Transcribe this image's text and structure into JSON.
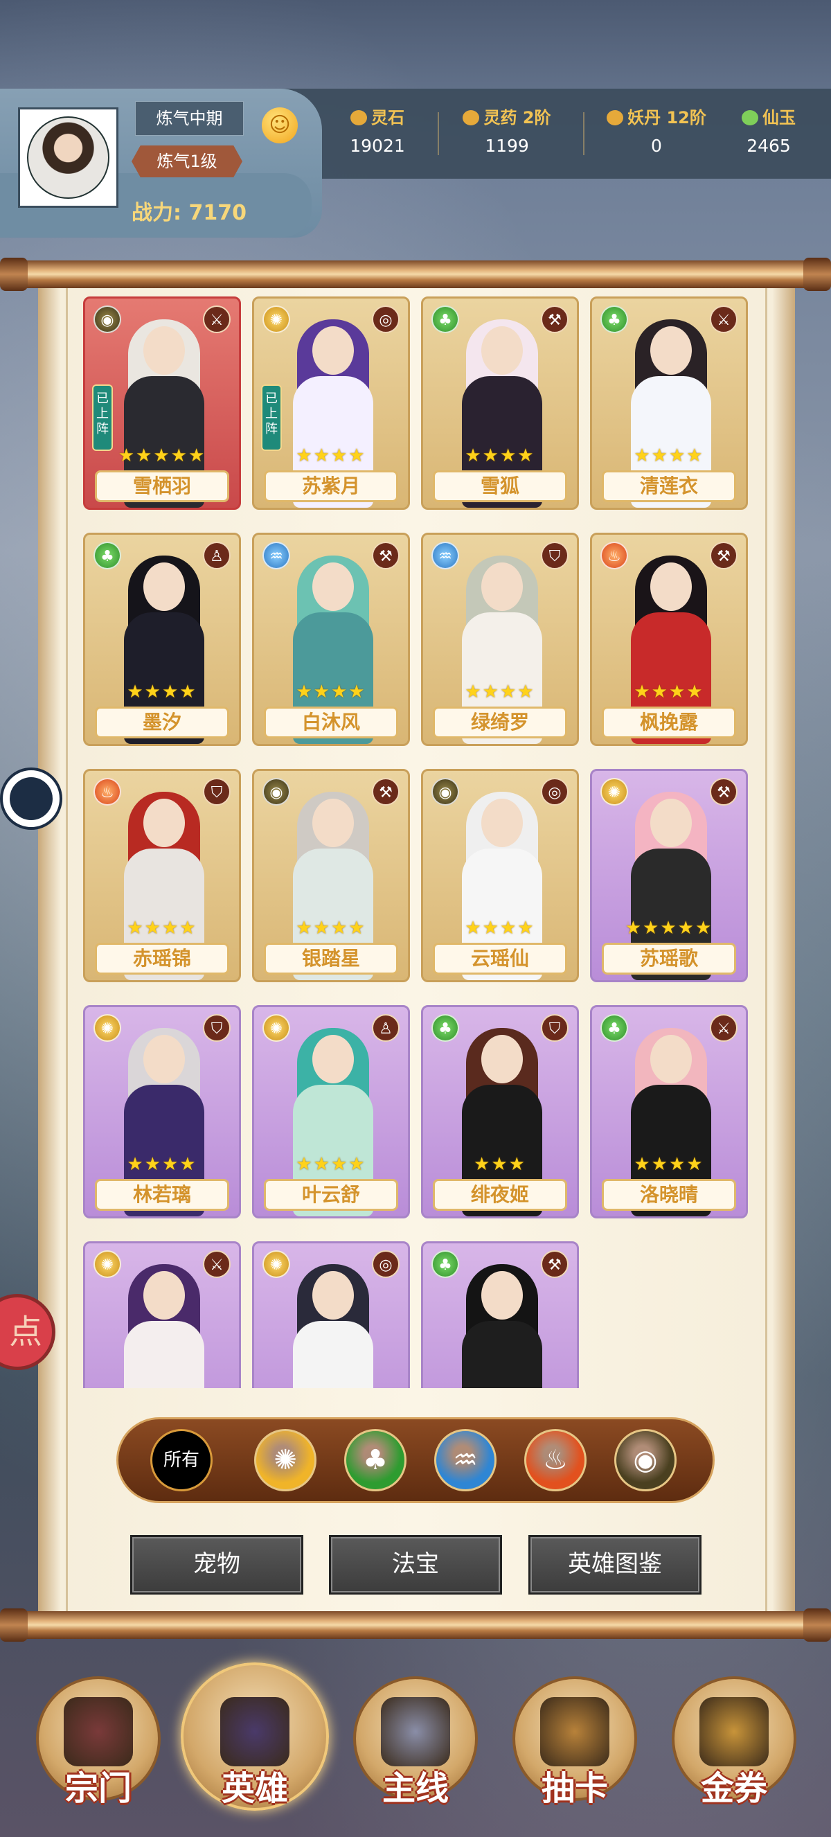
{
  "player": {
    "realm": "炼气中期",
    "level": "炼气1级",
    "power_label": "战力:",
    "power_value": "7170",
    "emoji_icon": "smile-icon"
  },
  "resources": [
    {
      "name": "灵石",
      "value": "19021",
      "icon": "spirit-stone-icon"
    },
    {
      "name": "灵药 2阶",
      "value": "1199",
      "icon": "herb-icon"
    },
    {
      "name": "妖丹 12阶",
      "value": "0",
      "icon": "demon-core-icon"
    },
    {
      "name": "仙玉",
      "value": "2465",
      "icon": "jade-icon"
    }
  ],
  "heroes": [
    {
      "name": "雪栖羽",
      "element": "earth",
      "role": "swords-icon",
      "stars": "★★★★★",
      "card": "red",
      "deployed": "已上阵",
      "hair": "#eae6e0",
      "body": "#2a2a30"
    },
    {
      "name": "苏紫月",
      "element": "metal",
      "role": "target-icon",
      "stars": "★★★★",
      "card": "gold",
      "deployed": "已上阵",
      "hair": "#5a3a9a",
      "body": "#f4f0ff"
    },
    {
      "name": "雪狐",
      "element": "wood",
      "role": "axes-icon",
      "stars": "★★★★",
      "card": "gold",
      "deployed": "",
      "hair": "#f4e6ee",
      "body": "#2a2230"
    },
    {
      "name": "清莲衣",
      "element": "wood",
      "role": "swords-icon",
      "stars": "★★★★",
      "card": "gold",
      "deployed": "",
      "hair": "#2a2226",
      "body": "#f4f6fb"
    },
    {
      "name": "墨汐",
      "element": "wood",
      "role": "priest-icon",
      "stars": "★★★★",
      "card": "gold",
      "deployed": "",
      "hair": "#15141a",
      "body": "#1e1e2a"
    },
    {
      "name": "白沐风",
      "element": "water",
      "role": "axes-icon",
      "stars": "★★★★",
      "card": "gold",
      "deployed": "",
      "hair": "#6cc2b2",
      "body": "#4c9a9a"
    },
    {
      "name": "绿绮罗",
      "element": "water",
      "role": "shield-icon",
      "stars": "★★★★",
      "card": "gold",
      "deployed": "",
      "hair": "#c4c8b8",
      "body": "#f4f0ea"
    },
    {
      "name": "枫挽露",
      "element": "fire",
      "role": "axes-icon",
      "stars": "★★★★",
      "card": "gold",
      "deployed": "",
      "hair": "#1a1418",
      "body": "#c82a2a"
    },
    {
      "name": "赤瑶锦",
      "element": "fire",
      "role": "shield-icon",
      "stars": "★★★★",
      "card": "gold",
      "deployed": "",
      "hair": "#b82a22",
      "body": "#e8e4e0"
    },
    {
      "name": "银踏星",
      "element": "earth",
      "role": "axes-icon",
      "stars": "★★★★",
      "card": "gold",
      "deployed": "",
      "hair": "#cfcac4",
      "body": "#dfe8e4"
    },
    {
      "name": "云瑶仙",
      "element": "earth",
      "role": "target-icon",
      "stars": "★★★★",
      "card": "gold",
      "deployed": "",
      "hair": "#efefef",
      "body": "#f6f6f6"
    },
    {
      "name": "苏瑶歌",
      "element": "metal",
      "role": "axes-icon",
      "stars": "★★★★★",
      "card": "purple",
      "deployed": "",
      "hair": "#f4b4c2",
      "body": "#2a2a2a"
    },
    {
      "name": "林若璃",
      "element": "metal",
      "role": "shield-icon",
      "stars": "★★★★",
      "card": "purple",
      "deployed": "",
      "hair": "#dad6d8",
      "body": "#3a2a6a"
    },
    {
      "name": "叶云舒",
      "element": "metal",
      "role": "priest-icon",
      "stars": "★★★★",
      "card": "purple",
      "deployed": "",
      "hair": "#3cb2a6",
      "body": "#bfe6d6"
    },
    {
      "name": "绯夜姬",
      "element": "wood",
      "role": "shield-icon",
      "stars": "★★★",
      "card": "purple",
      "deployed": "",
      "hair": "#5a2a1e",
      "body": "#1a1a1a"
    },
    {
      "name": "洛晓晴",
      "element": "wood",
      "role": "swords-icon",
      "stars": "★★★★",
      "card": "purple",
      "deployed": "",
      "hair": "#f2b6be",
      "body": "#1a1a1a"
    },
    {
      "name": "",
      "element": "metal",
      "role": "swords-icon",
      "stars": "",
      "card": "purple",
      "deployed": "",
      "hair": "#4a2a6a",
      "body": "#f4eeee"
    },
    {
      "name": "",
      "element": "metal",
      "role": "target-icon",
      "stars": "",
      "card": "purple",
      "deployed": "",
      "hair": "#2a2a3a",
      "body": "#f4f4f4"
    },
    {
      "name": "",
      "element": "wood",
      "role": "axes-icon",
      "stars": "",
      "card": "purple",
      "deployed": "",
      "hair": "#141414",
      "body": "#1e1e1e"
    }
  ],
  "filters": [
    {
      "label": "所有",
      "icon": "all"
    },
    {
      "label": "",
      "icon": "metal-element-icon",
      "color": "#f0b429"
    },
    {
      "label": "",
      "icon": "wood-element-icon",
      "color": "#2e9c30"
    },
    {
      "label": "",
      "icon": "water-element-icon",
      "color": "#2f86d4"
    },
    {
      "label": "",
      "icon": "fire-element-icon",
      "color": "#e2511e"
    },
    {
      "label": "",
      "icon": "earth-element-icon",
      "color": "#4a4020"
    }
  ],
  "actions": {
    "pets": "宠物",
    "treasure": "法宝",
    "codex": "英雄图鉴"
  },
  "side": {
    "dot_label": "点"
  },
  "nav": [
    {
      "label": "宗门",
      "icon": "pagoda-icon"
    },
    {
      "label": "英雄",
      "icon": "hero-icon",
      "active": true
    },
    {
      "label": "主线",
      "icon": "crossed-swords-icon"
    },
    {
      "label": "抽卡",
      "icon": "card-chest-icon"
    },
    {
      "label": "金券",
      "icon": "treasure-chest-icon"
    }
  ],
  "colors": {
    "accent_gold": "#f2c353",
    "nameplate_text": "#d4932c",
    "nav_label_stroke": "#a0321e"
  }
}
